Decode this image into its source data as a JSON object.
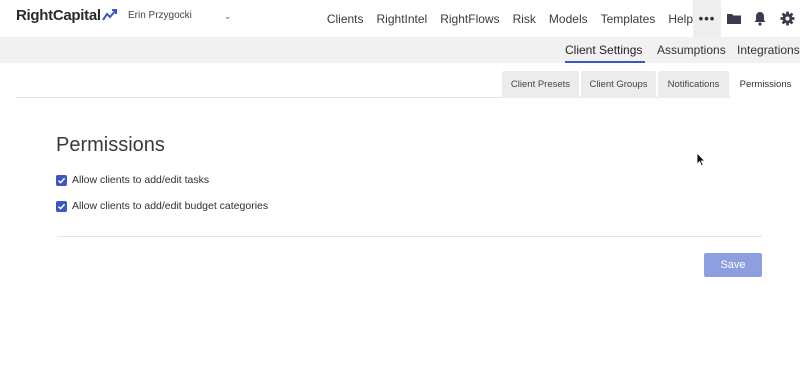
{
  "app": {
    "logo_text": "RightCapital",
    "advisor_name": "Erin Przygocki"
  },
  "nav": {
    "links": [
      "Clients",
      "RightIntel",
      "RightFlows",
      "Risk",
      "Models",
      "Templates",
      "Help"
    ],
    "more_label": "•••"
  },
  "subnav": {
    "tabs": [
      "Client Settings",
      "Assumptions",
      "Integrations"
    ],
    "active": "Client Settings"
  },
  "tabs": {
    "items": [
      "Client Presets",
      "Client Groups",
      "Notifications",
      "Permissions"
    ],
    "active": "Permissions"
  },
  "page": {
    "title": "Permissions",
    "options": [
      {
        "label": "Allow clients to add/edit tasks",
        "checked": true
      },
      {
        "label": "Allow clients to add/edit budget categories",
        "checked": true
      }
    ],
    "save_label": "Save"
  },
  "colors": {
    "accent": "#3c56c2",
    "save_disabled": "#8d9fe0",
    "icon_dark": "#3b3b4f"
  }
}
